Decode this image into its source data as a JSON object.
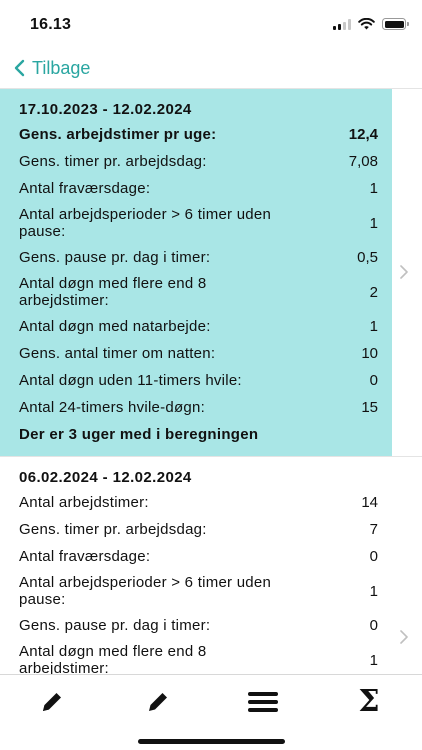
{
  "status_bar": {
    "time": "16.13"
  },
  "nav": {
    "back_label": "Tilbage"
  },
  "cards": [
    {
      "title": "17.10.2023 - 12.02.2024",
      "rows": [
        {
          "label": "Gens. arbejdstimer pr uge:",
          "value": "12,4",
          "bold": true
        },
        {
          "label": "Gens. timer pr. arbejdsdag:",
          "value": "7,08"
        },
        {
          "label": "Antal fraværsdage:",
          "value": "1"
        },
        {
          "label": "Antal arbejdsperioder > 6 timer uden pause:",
          "value": "1"
        },
        {
          "label": "Gens. pause pr. dag i timer:",
          "value": "0,5"
        },
        {
          "label": "Antal døgn med flere end 8 arbejdstimer:",
          "value": "2"
        },
        {
          "label": "Antal døgn med natarbejde:",
          "value": "1"
        },
        {
          "label": "Gens. antal timer om natten:",
          "value": "10"
        },
        {
          "label": "Antal døgn uden 11-timers hvile:",
          "value": "0"
        },
        {
          "label": "Antal 24-timers hvile-døgn:",
          "value": "15"
        }
      ],
      "footer": "Der er 3 uger med i beregningen"
    },
    {
      "title": "06.02.2024 - 12.02.2024",
      "rows": [
        {
          "label": "Antal arbejdstimer:",
          "value": "14"
        },
        {
          "label": "Gens. timer pr. arbejdsdag:",
          "value": "7"
        },
        {
          "label": "Antal fraværsdage:",
          "value": "0"
        },
        {
          "label": "Antal arbejdsperioder > 6 timer uden pause:",
          "value": "1"
        },
        {
          "label": "Gens. pause pr. dag i timer:",
          "value": "0"
        },
        {
          "label": "Antal døgn med flere end 8 arbejdstimer:",
          "value": "1"
        }
      ]
    }
  ],
  "tab_bar": {
    "tabs": [
      {
        "icon": "pencil-icon"
      },
      {
        "icon": "pencil-icon"
      },
      {
        "icon": "menu-icon"
      },
      {
        "icon": "sigma-icon",
        "glyph": "Σ"
      }
    ]
  },
  "colors": {
    "accent": "#2aa6a1",
    "highlight": "#a9e6e6"
  }
}
